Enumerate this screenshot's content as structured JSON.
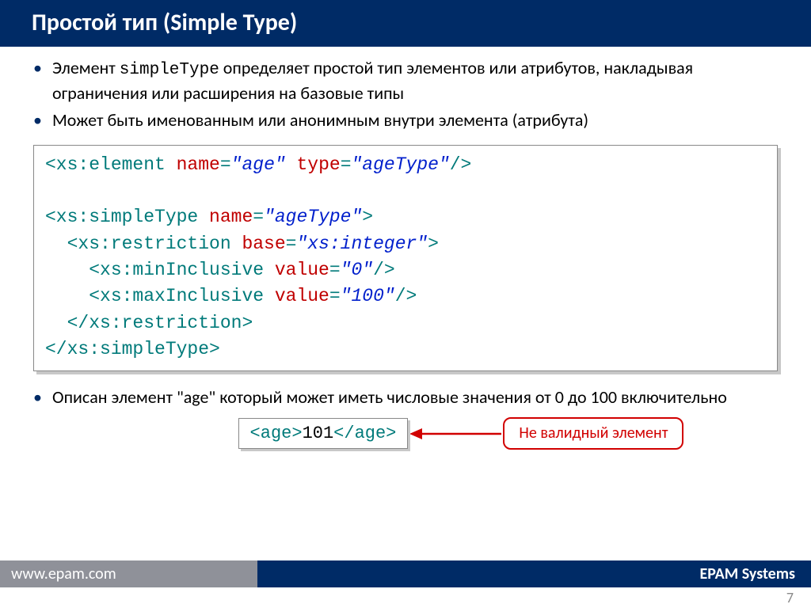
{
  "title": "Простой тип (Simple Type)",
  "bullets_top": [
    {
      "pre": "Элемент ",
      "mono": "simpleType",
      "post": " определяет простой тип элементов или атрибутов, накладывая ограничения или расширения на базовые типы"
    },
    {
      "pre": "Может быть именованным или анонимным внутри элемента (атрибута)",
      "mono": "",
      "post": ""
    }
  ],
  "code": {
    "l1": {
      "tag_open": "<xs:element",
      "a1n": " name",
      "a1v": "\"age\"",
      "a2n": " type",
      "a2v": "\"ageType\"",
      "close": "/>"
    },
    "l3": {
      "tag_open": "<xs:simpleType",
      "an": " name",
      "av": "\"ageType\"",
      "close": ">"
    },
    "l4": {
      "tag_open": "  <xs:restriction",
      "an": " base",
      "av": "\"xs:integer\"",
      "close": ">"
    },
    "l5": {
      "tag_open": "    <xs:minInclusive",
      "an": " value",
      "av": "\"0\"",
      "close": "/>"
    },
    "l6": {
      "tag_open": "    <xs:maxInclusive",
      "an": " value",
      "av": "\"100\"",
      "close": "/>"
    },
    "l7": "  </xs:restriction>",
    "l8": "</xs:simpleType>"
  },
  "bullets_bottom": [
    "Описан элемент  \"age\"  который может иметь числовые значения от 0 до 100 включительно"
  ],
  "example": {
    "open": "<age>",
    "val": "101",
    "close": "</age>"
  },
  "callout": "Не валидный элемент",
  "footer": {
    "left": "www.epam.com",
    "right": "EPAM Systems"
  },
  "page_number": "7"
}
